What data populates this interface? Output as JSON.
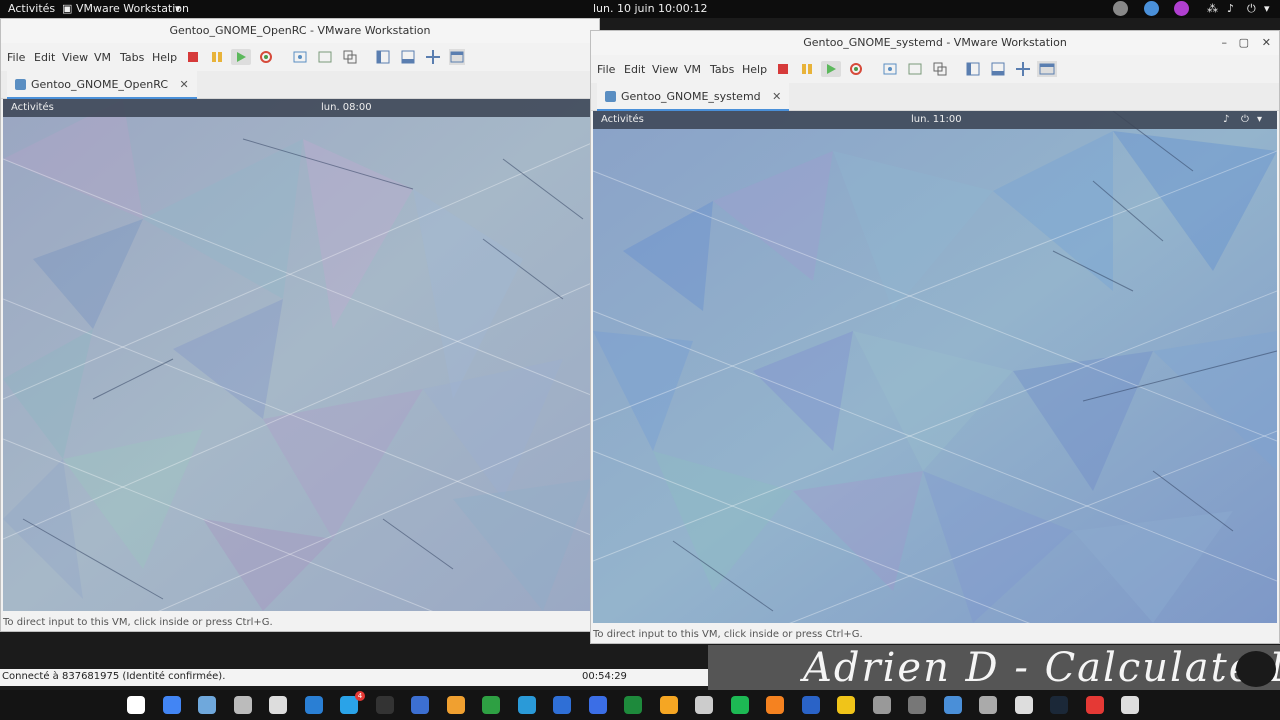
{
  "topbar": {
    "activities": "Activités",
    "app_menu": "VMware Workstation",
    "clock": "lun. 10 juin  10:00:12"
  },
  "left_window": {
    "title": "Gentoo_GNOME_OpenRC - VMware Workstation",
    "menu": [
      "File",
      "Edit",
      "View",
      "VM",
      "Tabs",
      "Help"
    ],
    "tab_label": "Gentoo_GNOME_OpenRC",
    "tab_close": "✕",
    "guest_activities": "Activités",
    "guest_clock": "lun. 08:00",
    "status_text": "To direct input to this VM, click inside or press Ctrl+G."
  },
  "right_window": {
    "title": "Gentoo_GNOME_systemd - VMware Workstation",
    "controls": [
      "–",
      "▢",
      "✕"
    ],
    "menu": [
      "File",
      "Edit",
      "View",
      "VM",
      "Tabs",
      "Help"
    ],
    "tab_label": "Gentoo_GNOME_systemd",
    "tab_close": "✕",
    "guest_activities": "Activités",
    "guest_clock": "lun. 11:00",
    "status_text": "To direct input to this VM, click inside or press Ctrl+G."
  },
  "connection": {
    "text": "Connecté à 837681975 (Identité confirmée).",
    "timer": "00:54:29"
  },
  "banner": {
    "signature": "Adrien D - Calculate Linux"
  },
  "dock": {
    "badge": "4",
    "icons": [
      "vivaldi-icon",
      "chrome-icon",
      "browser-icon",
      "tools-icon",
      "home-icon",
      "files-icon",
      "telegram-icon",
      "terminal-icon",
      "calculator-icon",
      "notes-icon",
      "monitor-icon",
      "vmware-icon",
      "writer-icon",
      "document-icon",
      "calc-icon",
      "archive-icon",
      "settings-icon",
      "spotify-icon",
      "fish-icon",
      "podcast-icon",
      "paint-icon",
      "media-icon",
      "vm-icon",
      "deluge-icon",
      "network-icon",
      "obs-icon",
      "steam-icon",
      "anydesk-icon",
      "app-grid-icon"
    ],
    "colors": [
      "#ffffff",
      "#4285f4",
      "#6fa8dc",
      "#bbbbbb",
      "#dddddd",
      "#2a7fd4",
      "#2aa3e8",
      "#333333",
      "#3c6fd1",
      "#f0a030",
      "#2ea043",
      "#2a9ad8",
      "#2f6fd6",
      "#3b6ee6",
      "#1e8a3c",
      "#f5a623",
      "#cccccc",
      "#1db954",
      "#f58220",
      "#2a63c7",
      "#f0c419",
      "#999999",
      "#777777",
      "#4a8fd8",
      "#aaaaaa",
      "#dddddd",
      "#1b2838",
      "#e53935",
      "#dddddd"
    ]
  }
}
